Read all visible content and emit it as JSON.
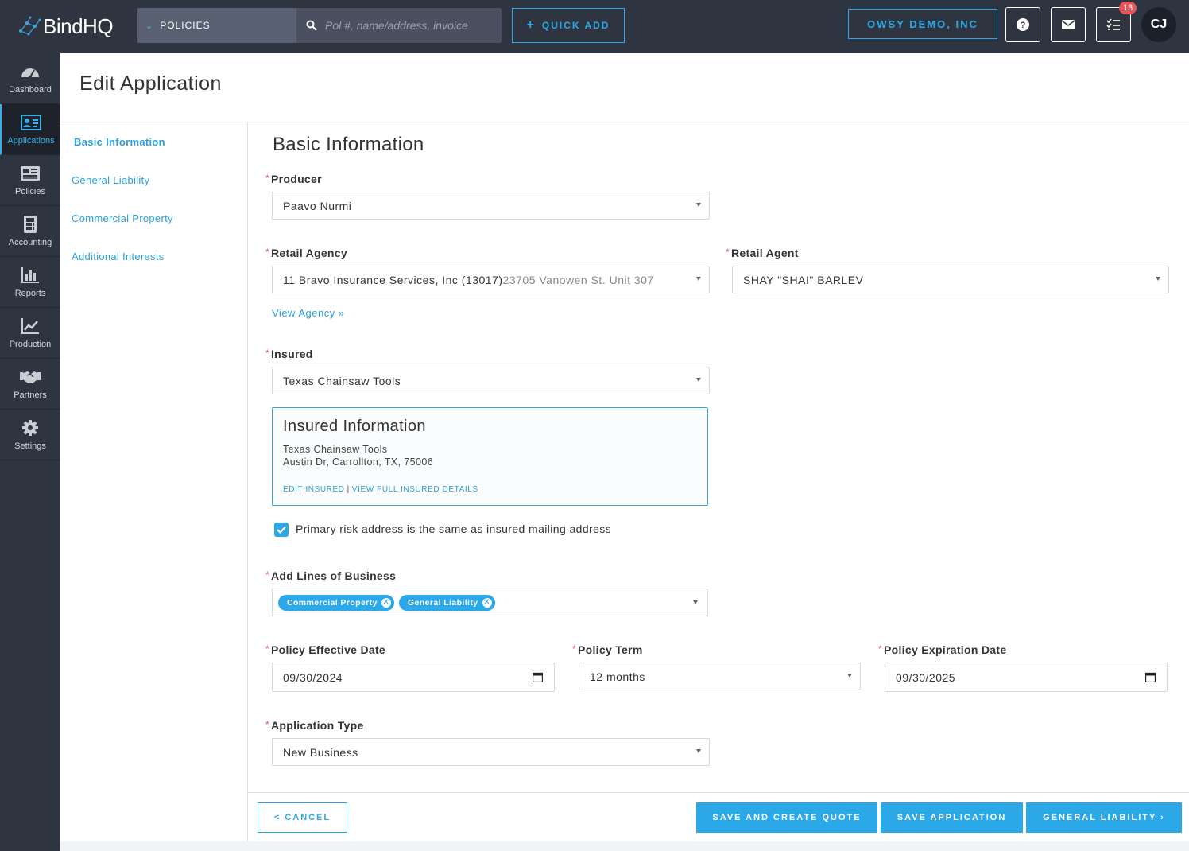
{
  "app": {
    "logo_text": "BindHQ"
  },
  "topbar": {
    "search_scope": "POLICIES",
    "search_placeholder": "Pol #, name/address, invoice",
    "quick_add_label": "QUICK ADD",
    "org_label": "OWSY DEMO, INC",
    "tasks_badge": "13",
    "avatar_initials": "CJ"
  },
  "rail": {
    "items": [
      {
        "label": "Dashboard",
        "icon": "dashboard-icon"
      },
      {
        "label": "Applications",
        "icon": "id-card-icon"
      },
      {
        "label": "Policies",
        "icon": "newspaper-icon"
      },
      {
        "label": "Accounting",
        "icon": "calculator-icon"
      },
      {
        "label": "Reports",
        "icon": "bar-chart-icon"
      },
      {
        "label": "Production",
        "icon": "line-chart-icon"
      },
      {
        "label": "Partners",
        "icon": "handshake-icon"
      },
      {
        "label": "Settings",
        "icon": "gear-icon"
      }
    ],
    "active_index": 1
  },
  "page": {
    "title": "Edit Application"
  },
  "section_nav": {
    "items": [
      "Basic Information",
      "General Liability",
      "Commercial Property",
      "Additional Interests"
    ]
  },
  "form": {
    "section_title": "Basic Information",
    "producer": {
      "label": "Producer",
      "value": "Paavo Nurmi"
    },
    "retail_agency": {
      "label": "Retail Agency",
      "value": "11 Bravo Insurance Services, Inc (13017)",
      "address": "23705 Vanowen St. Unit 307",
      "view_link": "View Agency »"
    },
    "retail_agent": {
      "label": "Retail Agent",
      "value": "SHAY \"SHAI\" BARLEV"
    },
    "insured": {
      "label": "Insured",
      "value": "Texas Chainsaw Tools"
    },
    "insured_info": {
      "title": "Insured Information",
      "name": "Texas Chainsaw Tools",
      "address": "Austin Dr, Carrollton, TX, 75006",
      "edit_link": "EDIT INSURED",
      "separator": "|",
      "details_link": "VIEW FULL INSURED DETAILS"
    },
    "primary_risk": {
      "label": "Primary risk address is the same as insured mailing address",
      "checked": true
    },
    "lines_of_business": {
      "label": "Add Lines of Business",
      "tags": [
        "Commercial Property",
        "General Liability"
      ]
    },
    "effective_date": {
      "label": "Policy Effective Date",
      "value": "09/30/2024"
    },
    "policy_term": {
      "label": "Policy Term",
      "value": "12 months"
    },
    "expiration_date": {
      "label": "Policy Expiration Date",
      "value": "09/30/2025"
    },
    "application_type": {
      "label": "Application Type",
      "value": "New Business"
    }
  },
  "footer": {
    "cancel_label": "< CANCEL",
    "save_quote_label": "SAVE AND CREATE QUOTE",
    "save_label": "SAVE APPLICATION",
    "next_label": "GENERAL LIABILITY ›"
  },
  "colors": {
    "accent": "#2aa8e8",
    "nav_bg": "#2f3540",
    "required": "#e5535b"
  }
}
